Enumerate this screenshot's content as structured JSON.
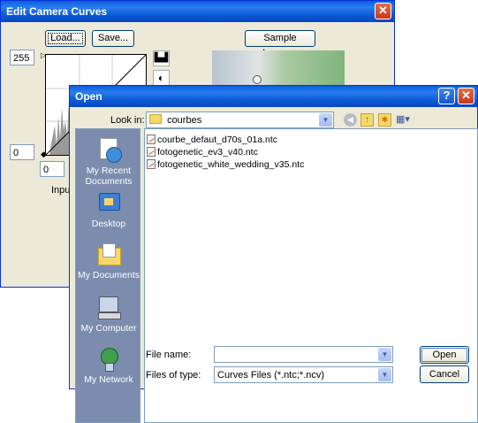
{
  "curves": {
    "title": "Edit Camera Curves",
    "load_label": "Load...",
    "save_label": "Save...",
    "sample_label": "Sample Image...",
    "output_max": "255",
    "output_min": "0",
    "input_min": "0",
    "input_label": "Input:"
  },
  "open": {
    "title": "Open",
    "look_in_label": "Look in:",
    "look_in_value": "courbes",
    "places": [
      {
        "label": "My Recent Documents",
        "icon": "recent-documents-icon"
      },
      {
        "label": "Desktop",
        "icon": "desktop-icon"
      },
      {
        "label": "My Documents",
        "icon": "my-documents-icon"
      },
      {
        "label": "My Computer",
        "icon": "my-computer-icon"
      },
      {
        "label": "My Network",
        "icon": "my-network-icon"
      }
    ],
    "files": [
      "courbe_defaut_d70s_01a.ntc",
      "fotogenetic_ev3_v40.ntc",
      "fotogenetic_white_wedding_v35.ntc"
    ],
    "file_name_label": "File name:",
    "file_name_value": "",
    "files_of_type_label": "Files of type:",
    "files_of_type_value": "Curves Files (*.ntc;*.ncv)",
    "open_label": "Open",
    "cancel_label": "Cancel"
  },
  "colors": {
    "titlebar": "#0a5fdc",
    "places_bg": "#7c8cae",
    "dialog_bg": "#ece9d8"
  }
}
